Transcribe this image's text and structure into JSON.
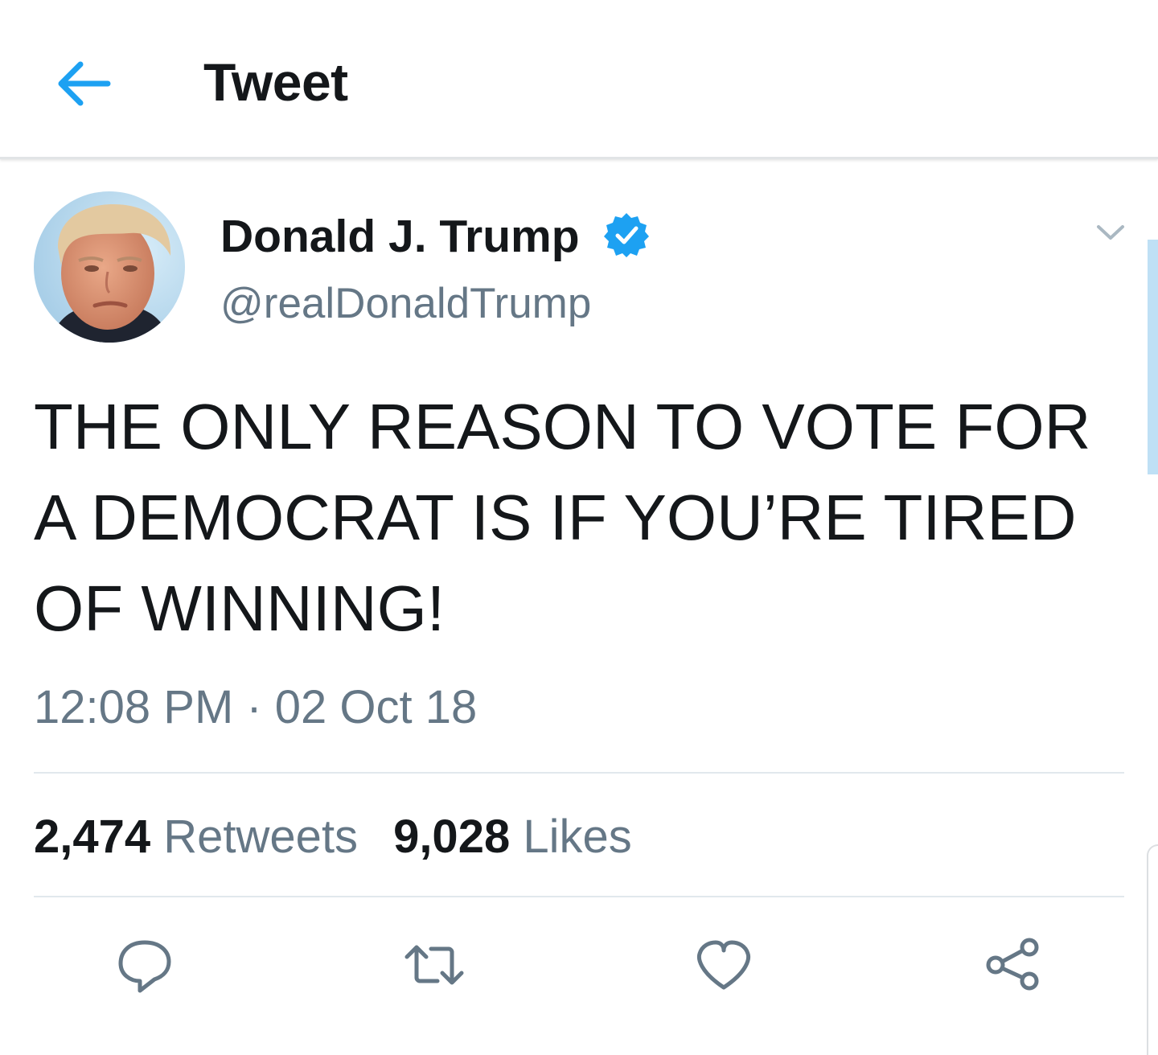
{
  "header": {
    "title": "Tweet",
    "back_icon": "arrow-left-icon"
  },
  "tweet": {
    "author": {
      "display_name": "Donald J. Trump",
      "handle": "@realDonaldTrump",
      "verified": true,
      "avatar": "profile-photo"
    },
    "text": "THE ONLY REASON TO VOTE FOR A DEMOCRAT IS IF YOU’RE TIRED OF WINNING!",
    "timestamp": "12:08 PM · 02 Oct 18",
    "stats": {
      "retweets_count": "2,474",
      "retweets_label": "Retweets",
      "likes_count": "9,028",
      "likes_label": "Likes"
    }
  },
  "actions": [
    {
      "name": "reply",
      "icon": "speech-bubble-icon"
    },
    {
      "name": "retweet",
      "icon": "retweet-arrows-icon"
    },
    {
      "name": "like",
      "icon": "heart-icon"
    },
    {
      "name": "share",
      "icon": "share-nodes-icon"
    }
  ],
  "colors": {
    "accent": "#1da1f2",
    "text_primary": "#14171a",
    "text_secondary": "#657786",
    "icon_gray": "#657786",
    "divider": "#e1e8ed"
  }
}
